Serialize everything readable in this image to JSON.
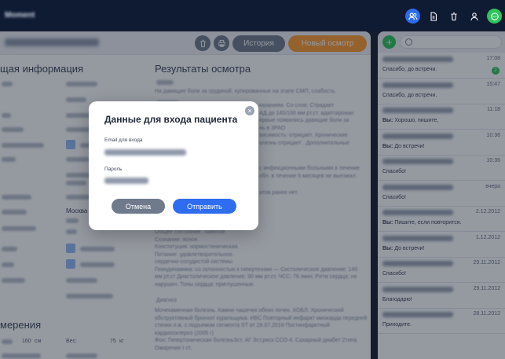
{
  "topbar": {
    "icons": [
      "users-icon",
      "document-icon",
      "trash-icon",
      "person-icon",
      "chat-icon"
    ]
  },
  "header": {
    "history_label": "История",
    "new_exam_label": "Новый осмотр"
  },
  "left_section": {
    "title": "щая информация",
    "city": "Москва",
    "measurements_title": "мерения",
    "height_value": "160",
    "height_unit": "см",
    "weight_label": "Вес:",
    "weight_value": "75",
    "weight_unit": "кг"
  },
  "exam_section": {
    "title": "Результаты осмотра",
    "complaint_text": "На давящие боли за грудиной, купированные на этапе СМП, слабость.",
    "right_fragments": [
      "казаниям. Со слов: Страдает",
      "АД до 140/100 мм рт.ст. адаптирован",
      "ервые появились давящие боли за",
      "нь в 3РАО",
      "висимость: отрицает. Хронические",
      "олезнь отрицает . Дополнительные"
    ],
    "contact_fragments": [
      "с инфекционными больными в течение",
      "обл. в течение 6 месяцев не выезжал."
    ],
    "prev_fragment": "атов ранее нет.",
    "status_lines": [
      "Общее состояние: тяжелое",
      "Сознание: ясное.",
      "Конституция: нормостеническая.",
      "Питание: удовлетворительное.",
      "сердечно-сосудистой системы",
      "Гемодинамика: со склонностью к гипертензии — Систолическое давление: 140",
      "мм рт.ст Диастолическое давление: 90 мм рт.ст. ЧСС: 76 /мин; Ритм сердца: не",
      "нарушен. Тоны сердца: приглушенные."
    ],
    "diagnosis_label": "Диагноз",
    "diagnosis_lines": [
      "Мочекаменная болезнь. Камни чашечек обеих почек. ХОБЛ: Хронический",
      "обструктивный бронхит курильщика. ИБС Повторный инфаркт миокарда передней",
      "стенки л.ж. с подъемом сегмента ST от 28.07.2018 Постинфарктный",
      "кардиосклероз (2005 г)",
      "Фон: Гипертоническая болезньЗст. АГ Зст.риск ССО-4. Сахарный диабет 2типа",
      "Ожирение I ст."
    ]
  },
  "modal": {
    "title": "Данные для входа пациента",
    "email_label": "Email для входа",
    "password_label": "Пароль",
    "cancel_label": "Отмена",
    "send_label": "Отправить"
  },
  "chat": {
    "items": [
      {
        "time": "17:08",
        "prefix": "",
        "message": "Спасибо, до встречи.",
        "badge": "2"
      },
      {
        "time": "15:47",
        "prefix": "",
        "message": "Спасибо, до встречи.",
        "badge": ""
      },
      {
        "time": "11:18",
        "prefix": "Вы:",
        "message": "Хорошо, пишите,",
        "badge": ""
      },
      {
        "time": "10:36",
        "prefix": "Вы:",
        "message": "До встречи!",
        "badge": ""
      },
      {
        "time": "10:36",
        "prefix": "",
        "message": "Спасибо!",
        "badge": ""
      },
      {
        "time": "вчера",
        "prefix": "",
        "message": "Спасибо!",
        "badge": ""
      },
      {
        "time": "2.12.2012",
        "prefix": "Вы:",
        "message": "Пишите, если повторится.",
        "badge": ""
      },
      {
        "time": "1.12.2012",
        "prefix": "Вы:",
        "message": "До встречи!",
        "badge": ""
      },
      {
        "time": "29.11.2012",
        "prefix": "",
        "message": "Спасибо!",
        "badge": ""
      },
      {
        "time": "29.11.2012",
        "prefix": "",
        "message": "Благодарю!",
        "badge": ""
      },
      {
        "time": "28.11.2012",
        "prefix": "",
        "message": "Приходите.",
        "badge": ""
      }
    ]
  }
}
